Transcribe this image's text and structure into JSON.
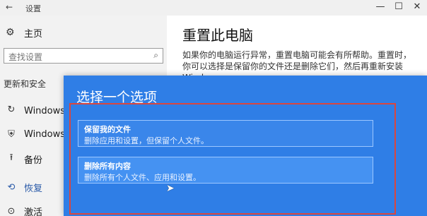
{
  "window": {
    "back_glyph": "←",
    "title": "设置",
    "minimize_glyph": "—",
    "maximize_glyph": "☐",
    "close_glyph": "✕"
  },
  "sidebar": {
    "home": {
      "icon": "gear-icon",
      "glyph": "⚙",
      "label": "主页"
    },
    "search": {
      "placeholder": "查找设置",
      "icon": "search-icon",
      "glyph": "⌕"
    },
    "section_label": "更新和安全",
    "items": [
      {
        "icon": "sync-icon",
        "glyph": "↻",
        "label": "Windows 更"
      },
      {
        "icon": "shield-icon",
        "glyph": "⛨",
        "label": "Windows D"
      },
      {
        "icon": "backup-icon",
        "glyph": "⭱",
        "label": "备份"
      },
      {
        "icon": "restore-icon",
        "glyph": "⟲",
        "label": "恢复"
      },
      {
        "icon": "activation-icon",
        "glyph": "⊙",
        "label": "激活"
      }
    ]
  },
  "main": {
    "title": "重置此电脑",
    "description": "如果你的电脑运行异常，重置电脑可能会有所帮助。重置时，你可以选择是保留你的文件还是删除它们，然后再重新安装 Windows。"
  },
  "dialog": {
    "title": "选择一个选项",
    "options": [
      {
        "title": "保留我的文件",
        "description": "删除应用和设置，但保留个人文件。"
      },
      {
        "title": "删除所有内容",
        "description": "删除所有个人文件、应用和设置。"
      }
    ]
  },
  "colors": {
    "dialog_bg": "#2f7ee6",
    "highlight_frame": "#d9473e",
    "active_nav": "#2a5aa8"
  }
}
